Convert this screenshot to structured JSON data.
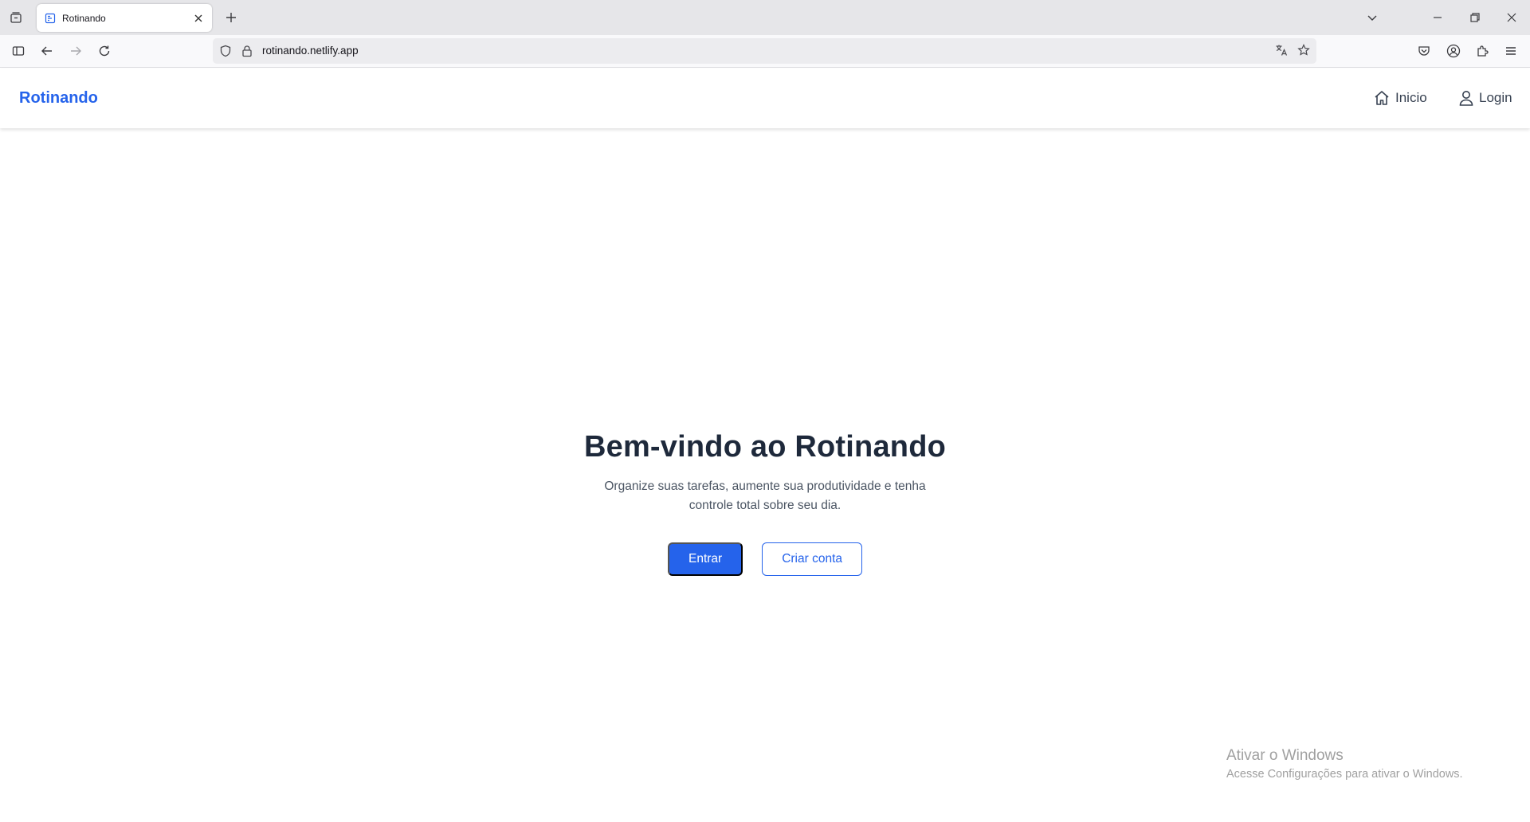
{
  "browser": {
    "tab": {
      "title": "Rotinando",
      "favicon": "page-icon"
    },
    "url": "rotinando.netlify.app",
    "icons": {
      "tab_list": "tab-list-icon",
      "new_tab": "plus-icon",
      "list_all_tabs": "chevron-down-icon",
      "minimize": "minimize-icon",
      "restore": "restore-icon",
      "close": "close-icon",
      "sidebar": "sidebar-icon",
      "back": "arrow-left-icon",
      "forward": "arrow-right-icon",
      "reload": "reload-icon",
      "tracking_protection": "shield-icon",
      "lock": "lock-icon",
      "translate": "translate-icon",
      "bookmark": "star-icon",
      "pocket": "pocket-icon",
      "account": "account-icon",
      "extensions": "puzzle-icon",
      "menu": "hamburger-icon"
    }
  },
  "header": {
    "brand": "Rotinando",
    "nav": [
      {
        "label": "Inicio",
        "icon": "home-icon"
      },
      {
        "label": "Login",
        "icon": "user-icon"
      }
    ]
  },
  "hero": {
    "title": "Bem-vindo ao Rotinando",
    "subtitle": "Organize suas tarefas, aumente sua produtividade e tenha controle total sobre seu dia.",
    "primary_button": "Entrar",
    "secondary_button": "Criar conta"
  },
  "watermark": {
    "title": "Ativar o Windows",
    "subtitle": "Acesse Configurações para ativar o Windows."
  },
  "colors": {
    "accent": "#2563eb",
    "heading": "#1e293b",
    "body_text": "#4b5563"
  }
}
